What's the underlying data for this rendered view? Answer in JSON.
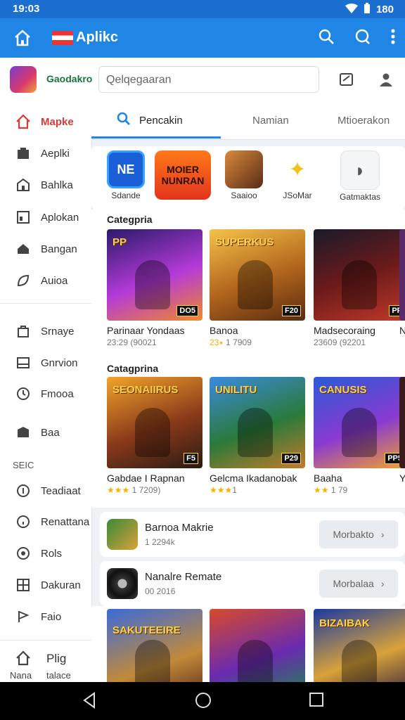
{
  "status": {
    "time": "19:03",
    "battery": "180"
  },
  "appbar": {
    "title": "Aplikc"
  },
  "search": {
    "user_name": "Gaodakro",
    "placeholder": "Qelqegaaran"
  },
  "sidebar": {
    "items": [
      {
        "label": "Mapke"
      },
      {
        "label": "Aeplki"
      },
      {
        "label": "Bahlka"
      },
      {
        "label": "Aplokan"
      },
      {
        "label": "Bangan"
      },
      {
        "label": "Auioa"
      },
      {
        "label": "Srnaye"
      },
      {
        "label": "Gnrvion"
      },
      {
        "label": "Fmooa"
      },
      {
        "label": "Baa"
      }
    ],
    "section": "SEIC",
    "items2": [
      {
        "label": "Teadiaat"
      },
      {
        "label": "Renattana"
      },
      {
        "label": "Rols"
      },
      {
        "label": "Dakuran"
      },
      {
        "label": "Faio"
      }
    ],
    "bottom": {
      "label1": "Plig",
      "label2a": "Nana",
      "label2b": "talace"
    }
  },
  "tabs": [
    "Pencakin",
    "Namian",
    "Mtioerakon"
  ],
  "featured": [
    {
      "name": "Sdande",
      "tile": "NE"
    },
    {
      "name": "",
      "tile": "MOIER NUNRAN"
    },
    {
      "name": "Saaioo",
      "tile": ""
    },
    {
      "name": "JSoMar",
      "tile": ""
    },
    {
      "name": "Gatmaktas",
      "tile": ""
    }
  ],
  "categories": [
    {
      "title": "Categpria",
      "cards": [
        {
          "title": "Parinaar Yondaas",
          "sub": "23:29 (90021",
          "stars": "",
          "art": "PP",
          "badge": "DO5"
        },
        {
          "title": "Banoa",
          "sub": "1 7909",
          "stars": "23⭑",
          "art": "SUPERKUS",
          "badge": "F20"
        },
        {
          "title": "Madsecoraing",
          "sub": "23609 (92201",
          "stars": "",
          "art": "",
          "badge": "PP"
        },
        {
          "title": "N",
          "sub": "",
          "stars": "",
          "art": "",
          "badge": ""
        }
      ]
    },
    {
      "title": "Catagprina",
      "cards": [
        {
          "title": "Gabdae I Rapnan",
          "sub": "1 7209)",
          "stars": "★★★",
          "art": "SEONAIIRUS",
          "badge": "F5"
        },
        {
          "title": "Gelcma Ikadanobak",
          "sub": "1",
          "stars": "★★★",
          "art": "UNILITU",
          "badge": "P29"
        },
        {
          "title": "Baaha",
          "sub": "1 79",
          "stars": "★★",
          "art": "CANUSIS",
          "badge": "PP5"
        },
        {
          "title": "Y",
          "sub": "",
          "stars": "",
          "art": "",
          "badge": ""
        }
      ]
    }
  ],
  "rows": [
    {
      "title": "Barnoa Makrie",
      "sub": "1 2294k",
      "button": "Morbakto"
    },
    {
      "title": "Nanalre Remate",
      "sub": "00 2016",
      "button": "Morbalaa"
    }
  ],
  "bottom_cards": [
    {
      "art": "SAKUTEEIRE"
    },
    {
      "art": ""
    },
    {
      "art": "BIZAIBAK"
    }
  ],
  "colors": {
    "accent": "#1f86e6",
    "active_red": "#d83a3a",
    "star": "#f1b400"
  }
}
